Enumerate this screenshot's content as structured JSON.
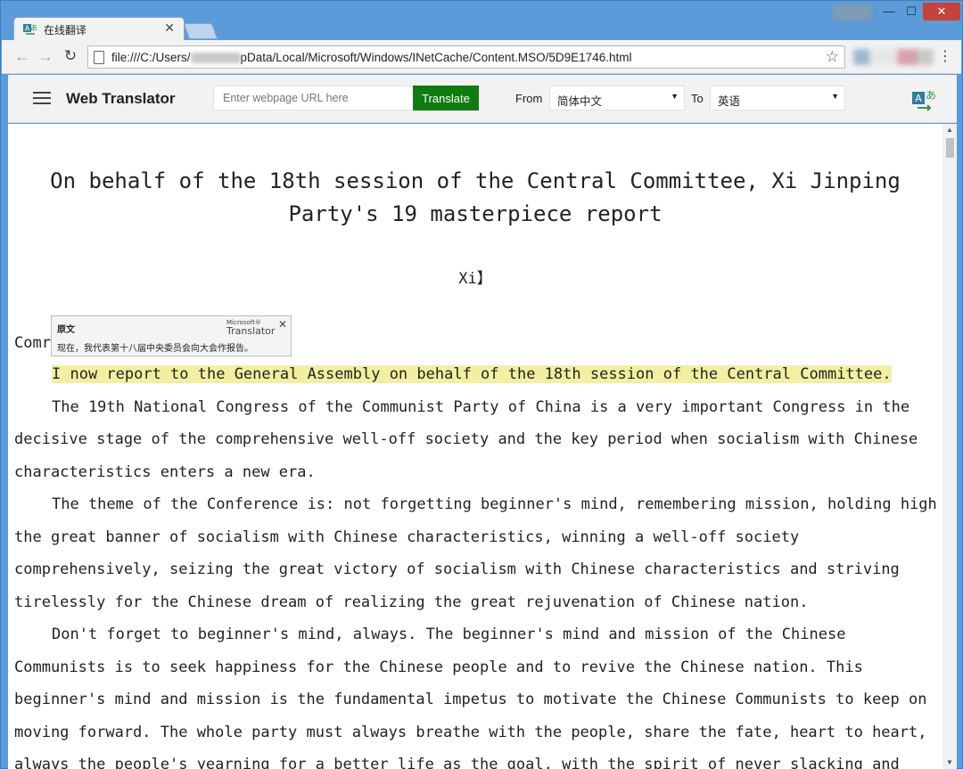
{
  "browser": {
    "tab_title": "在线翻译",
    "url_prefix": "file:///C:/Users/",
    "url_suffix": "pData/Local/Microsoft/Windows/INetCache/Content.MSO/5D9E1746.html"
  },
  "translator": {
    "brand": "Web Translator",
    "url_placeholder": "Enter webpage URL here",
    "translate_button": "Translate",
    "from_label": "From",
    "from_value": "简体中文",
    "to_label": "To",
    "to_value": "英语"
  },
  "tooltip": {
    "label": "原文",
    "brand_top": "Microsoft®",
    "brand_main": "Translator",
    "original_text": "现在，我代表第十八届中央委员会向大会作报告。"
  },
  "document": {
    "title_line1": "On behalf of the 18th session of the Central Committee, Xi Jinping",
    "title_line2": "Party's 19 masterpiece report",
    "author": "Xi】",
    "comr": "Comr",
    "highlight": "I now report to the General Assembly on behalf of the 18th session of the Central Committee.",
    "para1": "The 19th National Congress of the Communist Party of China is a very important Congress in the decisive stage of the comprehensive well-off society and the key period when socialism with Chinese characteristics enters a new era.",
    "para2": "The theme of the Conference is: not forgetting beginner's mind, remembering mission, holding high the great banner of socialism with Chinese characteristics, winning a well-off society comprehensively, seizing the great victory of socialism with Chinese characteristics and striving tirelessly for the Chinese dream of realizing the great rejuvenation of Chinese nation.",
    "para3": "Don't forget to beginner's mind, always. The beginner's mind and mission of the Chinese Communists is to seek happiness for the Chinese people and to revive the Chinese nation. This beginner's mind and mission is the fundamental impetus to motivate the Chinese Communists to keep on moving forward. The whole party must always breathe with the people, share the fate, heart to heart, always the people's yearning for a better life as the goal, with the spirit of never slacking and"
  },
  "colors": {
    "translate_button": "#107c10",
    "highlight": "#f2f0a0",
    "window_frame": "#5b9bd9",
    "close_button": "#c8413a"
  }
}
